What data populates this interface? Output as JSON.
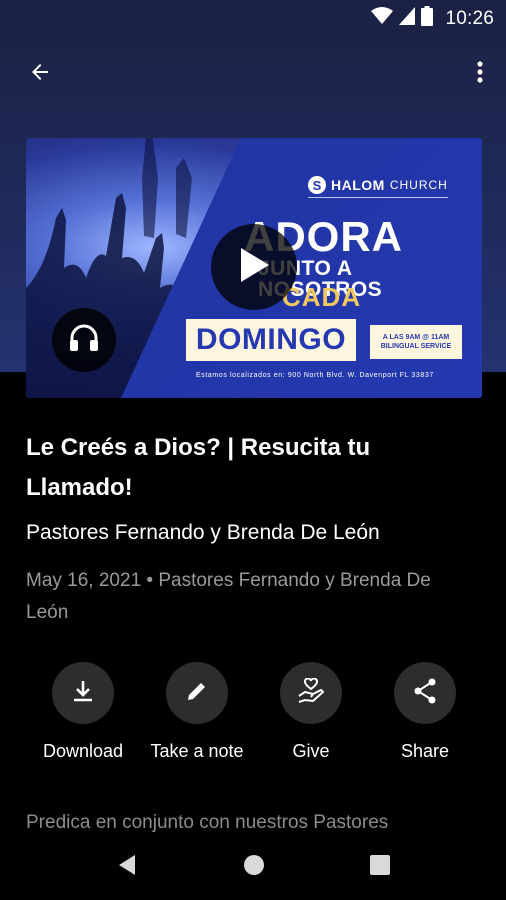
{
  "status_bar": {
    "time": "10:26",
    "icons": [
      "wifi-icon",
      "cellular-signal-icon",
      "battery-icon"
    ]
  },
  "app_bar": {
    "back_icon": "arrow-back-icon",
    "menu_icon": "more-vert-icon"
  },
  "artwork": {
    "logo_letter": "S",
    "logo_name": "HALOM",
    "logo_suffix": "CHURCH",
    "headline": "ADORA",
    "subline": "JUNTO A NOSOTROS",
    "cada": "CADA",
    "day": "DOMINGO",
    "service_line1": "A LAS 9AM @ 11AM",
    "service_line2": "BILINGUAL SERVICE",
    "address": "Estamos localizados en: 900 North Blvd. W. Davenport FL 33837",
    "play_icon": "play-icon",
    "audio_icon": "headphones-icon"
  },
  "sermon": {
    "title": "Le Creés a Dios? | Resucita tu Llamado!",
    "speaker": "Pastores Fernando y Brenda De León",
    "meta": "May 16, 2021 • Pastores Fernando y Brenda De León",
    "description": "Predica en conjunto con nuestros Pastores"
  },
  "actions": [
    {
      "label": "Download",
      "icon": "download-icon"
    },
    {
      "label": "Take a note",
      "icon": "pencil-icon"
    },
    {
      "label": "Give",
      "icon": "give-heart-hand-icon"
    },
    {
      "label": "Share",
      "icon": "share-icon"
    }
  ],
  "nav_bar": {
    "icons": [
      "nav-back-icon",
      "nav-home-icon",
      "nav-recents-icon"
    ]
  },
  "colors": {
    "hero_background": "#1f2a5a",
    "artwork_blue": "#2438b0",
    "accent_gold": "#f0c95e",
    "action_circle": "#2d2d2d",
    "meta_text": "#9a9a9a"
  }
}
